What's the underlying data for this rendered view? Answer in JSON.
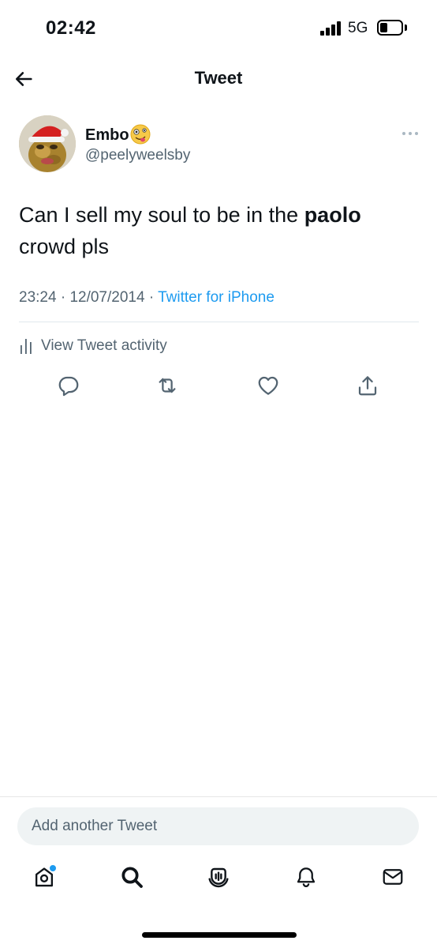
{
  "status_bar": {
    "time": "02:42",
    "network": "5G"
  },
  "nav": {
    "title": "Tweet",
    "back_icon": "arrow-left-icon"
  },
  "author": {
    "display_name": "Embo",
    "badge_emoji": "🤪",
    "handle": "@peelyweelsby"
  },
  "tweet": {
    "text_before": "Can I sell my soul to be in the ",
    "text_bold": "paolo",
    "text_after": " crowd pls",
    "time": "23:24",
    "date": "12/07/2014",
    "separator": "·",
    "source": "Twitter for iPhone"
  },
  "activity": {
    "label": "View Tweet activity"
  },
  "actions": [
    "reply-icon",
    "retweet-icon",
    "like-icon",
    "share-icon"
  ],
  "compose": {
    "placeholder": "Add another Tweet"
  },
  "tabs": [
    "home-icon",
    "search-icon",
    "spaces-icon",
    "notifications-icon",
    "messages-icon"
  ],
  "colors": {
    "accent": "#1d9bf0",
    "secondary_text": "#536471",
    "primary_text": "#0f1419"
  }
}
